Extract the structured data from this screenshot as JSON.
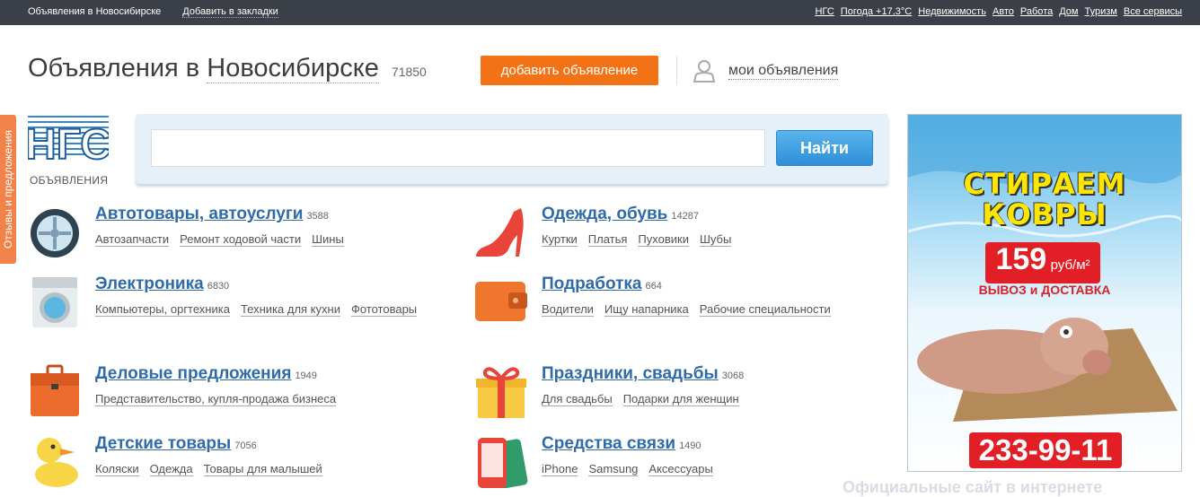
{
  "topbar": {
    "site_label": "Объявления в Новосибирске",
    "bookmark": "Добавить в закладки",
    "links": [
      "НГС",
      "Погода +17,3°C",
      "Недвижимость",
      "Авто",
      "Работа",
      "Дом",
      "Туризм",
      "Все сервисы"
    ]
  },
  "header": {
    "title_prefix": "Объявления в",
    "title_city": "Новосибирске",
    "count": "71850",
    "add_button": "добавить объявление",
    "my_ads": "мои объявления"
  },
  "feedback_tab": "Отзывы и предложения",
  "logo": {
    "mark": "НГС",
    "caption": "ОБЪЯВЛЕНИЯ"
  },
  "search": {
    "value": "",
    "button": "Найти"
  },
  "categories": [
    {
      "title": "Автотовары, автоуслуги",
      "count": "3588",
      "icon": "wheel-icon",
      "subs": [
        "Автозапчасти",
        "Ремонт ходовой части",
        "Шины"
      ]
    },
    {
      "title": "Одежда, обувь",
      "count": "14287",
      "icon": "shoe-icon",
      "subs": [
        "Куртки",
        "Платья",
        "Пуховики",
        "Шубы"
      ]
    },
    {
      "title": "Электроника",
      "count": "6830",
      "icon": "washing-machine-icon",
      "subs": [
        "Компьютеры, оргтехника",
        "Техника для кухни",
        "Фототовары"
      ]
    },
    {
      "title": "Подработка",
      "count": "664",
      "icon": "wallet-icon",
      "subs": [
        "Водители",
        "Ищу напарника",
        "Рабочие специальности"
      ]
    },
    {
      "title": "Деловые предложения",
      "count": "1949",
      "icon": "briefcase-icon",
      "subs": [
        "Представительство, купля-продажа бизнеса"
      ]
    },
    {
      "title": "Праздники, свадьбы",
      "count": "3068",
      "icon": "gift-icon",
      "subs": [
        "Для свадьбы",
        "Подарки для женщин"
      ]
    },
    {
      "title": "Детские товары",
      "count": "7056",
      "icon": "duck-icon",
      "subs": [
        "Коляски",
        "Одежда",
        "Товары для малышей"
      ]
    },
    {
      "title": "Средства связи",
      "count": "1490",
      "icon": "phone-icon",
      "subs": [
        "iPhone",
        "Samsung",
        "Аксессуары"
      ]
    }
  ],
  "banner": {
    "line1": "СТИРАЕМ",
    "line2": "КОВРЫ",
    "price_num": "159",
    "price_unit": "руб/м²",
    "delivery": "ВЫВОЗ и ДОСТАВКА",
    "phone": "233-99-11"
  },
  "watermark": "Официальные сайт в интернете Siteofficial.ru"
}
